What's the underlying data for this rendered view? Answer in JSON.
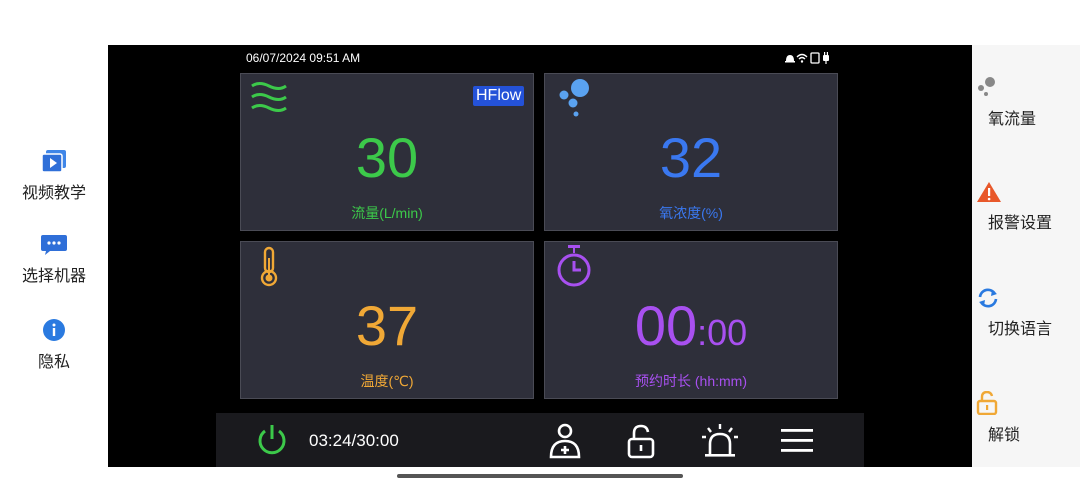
{
  "left_sidebar": {
    "items": [
      {
        "label": "视频教学",
        "icon": "video-icon"
      },
      {
        "label": "选择机器",
        "icon": "chat-bubble-icon"
      },
      {
        "label": "隐私",
        "icon": "info-icon"
      }
    ]
  },
  "right_sidebar": {
    "items": [
      {
        "label": "氧流量",
        "icon": "bubbles-icon"
      },
      {
        "label": "报警设置",
        "icon": "warning-icon"
      },
      {
        "label": "切换语言",
        "icon": "refresh-icon"
      },
      {
        "label": "解锁",
        "icon": "unlock-icon"
      }
    ]
  },
  "status_bar": {
    "datetime": "06/07/2024 09:51 AM"
  },
  "cards": {
    "flow": {
      "value": "30",
      "label": "流量(L/min)",
      "badge": "HFlow",
      "color": "#3cc94a"
    },
    "oxygen": {
      "value": "32",
      "label": "氧浓度(%)",
      "color": "#3a78f0"
    },
    "temperature": {
      "value": "37",
      "label": "温度(℃)",
      "color": "#f0a836"
    },
    "schedule": {
      "value_main": "00",
      "value_sub": ":00",
      "label": "预约时长 (hh:mm)",
      "color": "#a850f0"
    }
  },
  "bottom_bar": {
    "timer": "03:24/30:00"
  },
  "colors": {
    "screen_bg": "#000000",
    "card_bg": "#2e2f3a",
    "power_green": "#3cc94a",
    "warning_orange": "#e8582a",
    "info_blue": "#2a7ae0"
  }
}
